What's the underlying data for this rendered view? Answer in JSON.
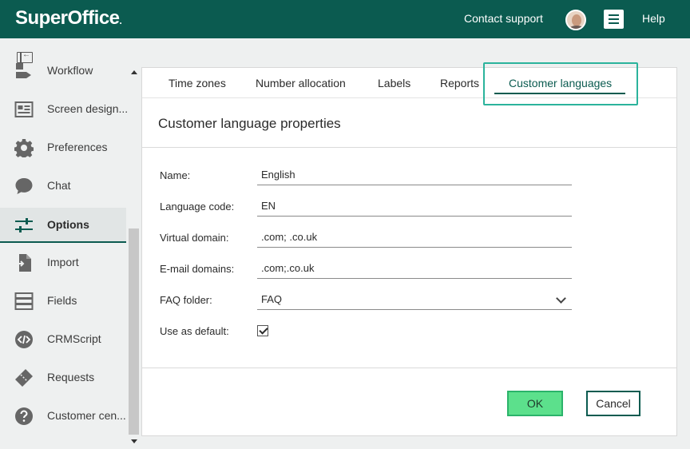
{
  "header": {
    "logo": "SuperOffice",
    "logo_mark": ".",
    "contact_support": "Contact support",
    "help": "Help"
  },
  "sidebar": {
    "items": [
      {
        "label": "Workflow",
        "icon": "workflow-icon"
      },
      {
        "label": "Screen design...",
        "icon": "screen-designer-icon"
      },
      {
        "label": "Preferences",
        "icon": "gear-icon"
      },
      {
        "label": "Chat",
        "icon": "chat-bubble-icon"
      },
      {
        "label": "Options",
        "icon": "sliders-icon",
        "active": true
      },
      {
        "label": "Import",
        "icon": "import-icon"
      },
      {
        "label": "Fields",
        "icon": "fields-icon"
      },
      {
        "label": "CRMScript",
        "icon": "code-icon"
      },
      {
        "label": "Requests",
        "icon": "ticket-icon"
      },
      {
        "label": "Customer cen...",
        "icon": "question-icon"
      }
    ]
  },
  "tabs": {
    "time_zones": "Time zones",
    "number_allocation": "Number allocation",
    "labels": "Labels",
    "reports": "Reports",
    "customer_languages": "Customer languages"
  },
  "form": {
    "title": "Customer language properties",
    "name_label": "Name:",
    "name_value": "English",
    "code_label": "Language code:",
    "code_value": "EN",
    "virtual_label": "Virtual domain:",
    "virtual_value": ".com; .co.uk",
    "email_label": "E-mail domains:",
    "email_value": ".com;.co.uk",
    "faq_label": "FAQ folder:",
    "faq_value": "FAQ",
    "default_label": "Use as default:",
    "default_checked": true
  },
  "buttons": {
    "ok": "OK",
    "cancel": "Cancel"
  },
  "colors": {
    "brand": "#0b5b50",
    "ok_button": "#5ce08c",
    "focus_ring": "#2bb39c"
  }
}
